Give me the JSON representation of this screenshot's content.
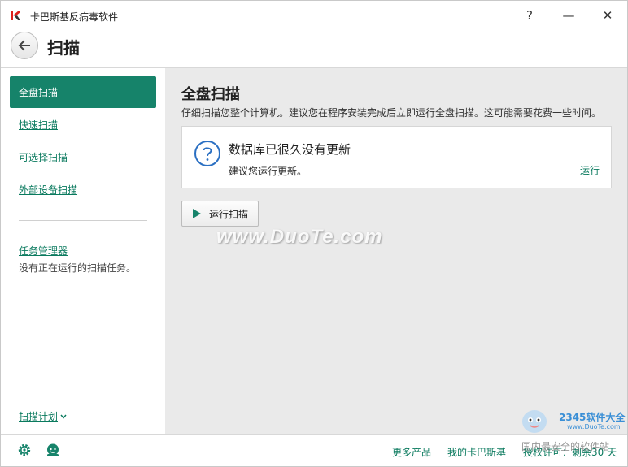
{
  "window": {
    "app_title": "卡巴斯基反病毒软件",
    "help_label": "?",
    "minimize_label": "—",
    "close_label": "✕"
  },
  "header": {
    "title": "扫描"
  },
  "sidebar": {
    "items": [
      {
        "label": "全盘扫描",
        "active": true
      },
      {
        "label": "快速扫描",
        "active": false
      },
      {
        "label": "可选择扫描",
        "active": false
      },
      {
        "label": "外部设备扫描",
        "active": false
      }
    ],
    "task_manager_label": "任务管理器",
    "task_status": "没有正在运行的扫描任务。",
    "schedule_label": "扫描计划"
  },
  "main": {
    "title": "全盘扫描",
    "description": "仔细扫描您整个计算机。建议您在程序安装完成后立即运行全盘扫描。这可能需要花费一些时间。",
    "notice": {
      "title": "数据库已很久没有更新",
      "subtitle": "建议您运行更新。",
      "link": "运行"
    },
    "run_button_label": "运行扫描",
    "watermark": "www.DuoTe.com"
  },
  "footer": {
    "more_products": "更多产品",
    "my_kaspersky": "我的卡巴斯基",
    "license": "授权许可：剩余30 天"
  },
  "corner_logo": {
    "brand": "2345软件大全",
    "url": "www.DuoTe.com",
    "tag": "国内最安全的软件站"
  },
  "colors": {
    "accent": "#16836a",
    "link": "#0a7a5e",
    "main_bg": "#eaeaea",
    "brand_red": "#e0201b"
  }
}
